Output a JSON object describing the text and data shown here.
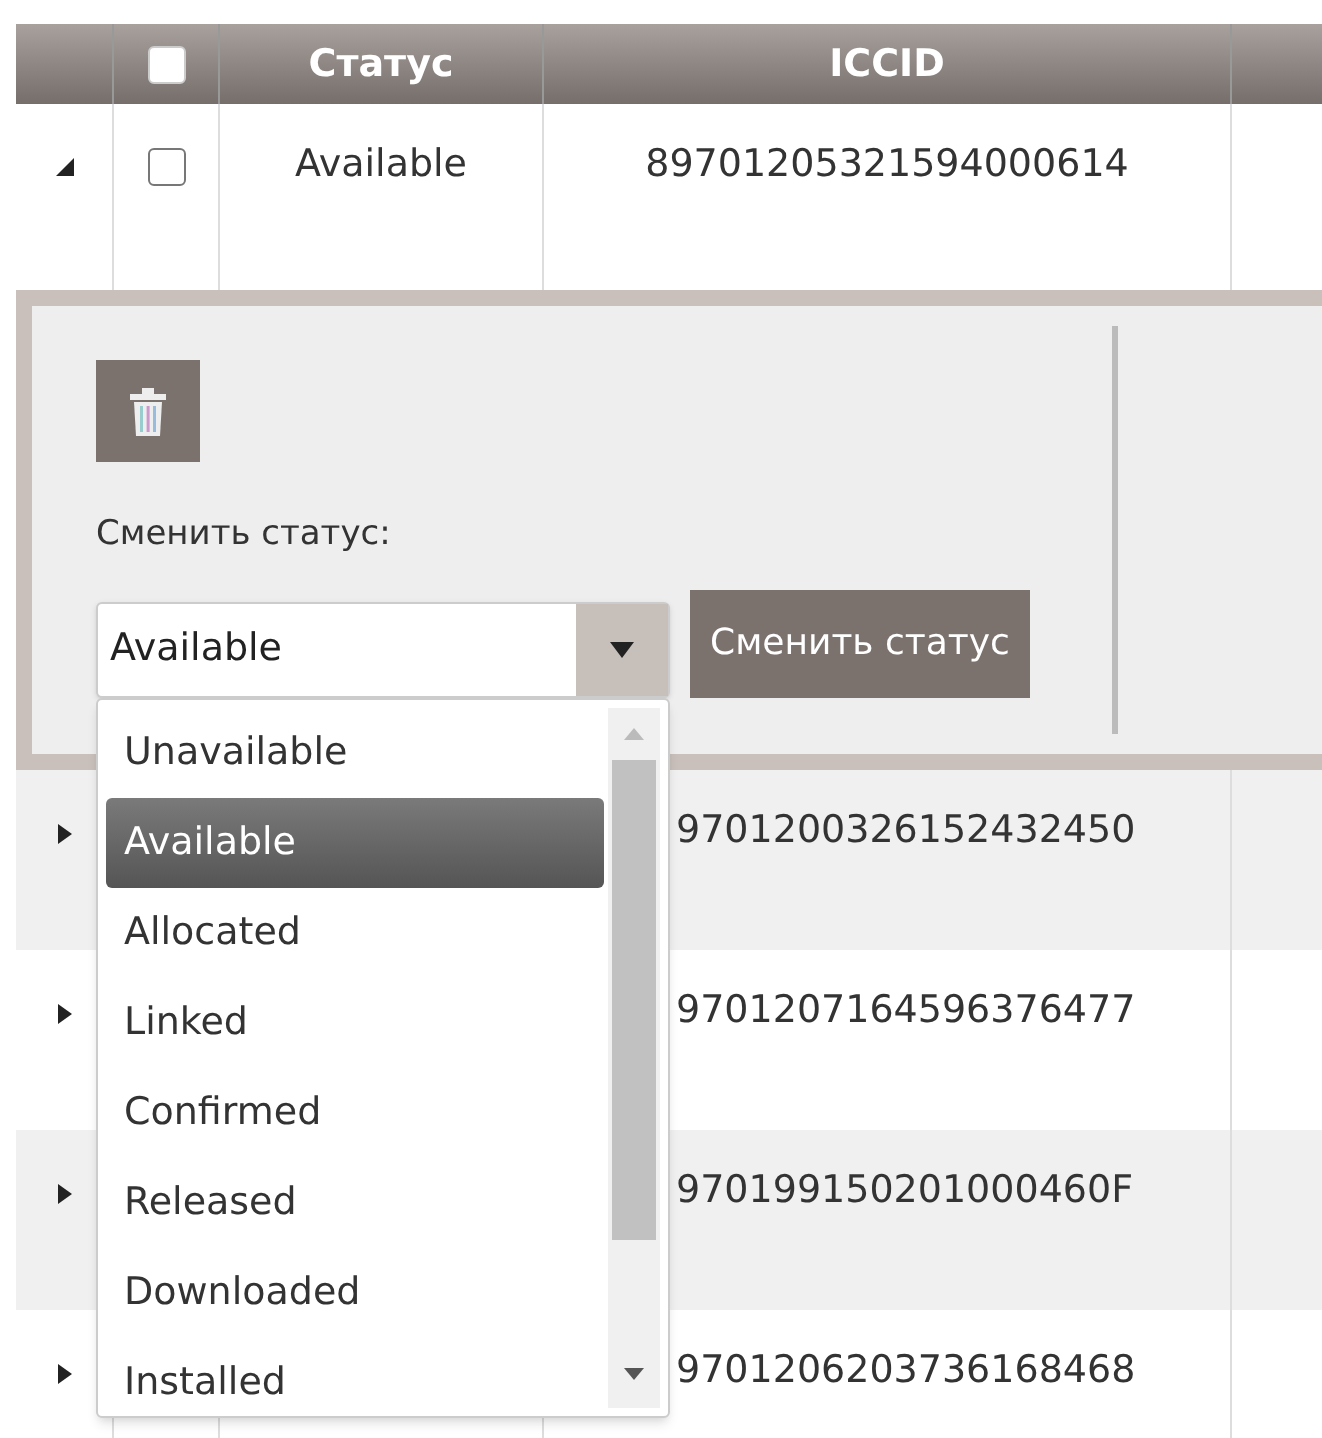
{
  "table": {
    "columns": [
      {
        "label": "Статус"
      },
      {
        "label": "ICCID"
      }
    ],
    "header_checkbox": {
      "checked": false
    },
    "rows": [
      {
        "kind": "full",
        "expanded": true,
        "checked": false,
        "status": "Available",
        "iccid": "89701205321594000614"
      },
      {
        "kind": "overlapped",
        "expanded": false,
        "iccid": "9701200326152432450"
      },
      {
        "kind": "overlapped",
        "expanded": false,
        "iccid": "9701207164596376477"
      },
      {
        "kind": "overlapped",
        "expanded": false,
        "iccid": "970199150201000460F"
      },
      {
        "kind": "overlapped",
        "expanded": false,
        "iccid": "9701206203736168468"
      }
    ]
  },
  "detail": {
    "status_label": "Сменить статус:",
    "select": {
      "value": "Available",
      "open": true,
      "options": [
        {
          "label": "Unavailable",
          "selected": false
        },
        {
          "label": "Available",
          "selected": true
        },
        {
          "label": "Allocated",
          "selected": false
        },
        {
          "label": "Linked",
          "selected": false
        },
        {
          "label": "Confirmed",
          "selected": false
        },
        {
          "label": "Released",
          "selected": false
        },
        {
          "label": "Downloaded",
          "selected": false
        },
        {
          "label": "Installed",
          "selected": false
        }
      ]
    },
    "button": "Сменить статус"
  }
}
